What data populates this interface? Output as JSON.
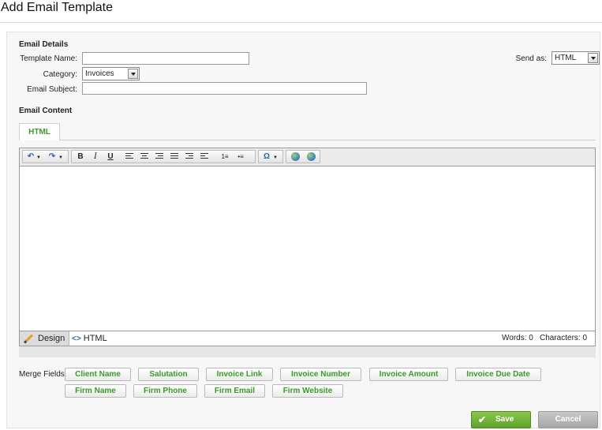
{
  "page": {
    "title": "Add Email Template"
  },
  "details": {
    "section_title": "Email Details",
    "template_name_label": "Template Name:",
    "template_name_value": "",
    "category_label": "Category:",
    "category_value": "Invoices",
    "subject_label": "Email Subject:",
    "subject_value": "",
    "send_as_label": "Send as:",
    "send_as_value": "HTML"
  },
  "content": {
    "section_title": "Email Content",
    "tab_label": "HTML"
  },
  "toolbar": {
    "undo": "↶",
    "redo": "↷",
    "dropdown": "▼",
    "bold": "B",
    "italic": "I",
    "underline": "U",
    "special_char": "Ω",
    "ordered_list": "1≡",
    "unordered_list": "•≡"
  },
  "editor": {
    "design_tab": "Design",
    "html_tab_icon": "<>",
    "html_tab": "HTML",
    "words": "Words: 0",
    "characters": "Characters: 0"
  },
  "merge": {
    "label": "Merge Fields:",
    "fields": [
      "Client Name",
      "Salutation",
      "Invoice Link",
      "Invoice Number",
      "Invoice Amount",
      "Invoice Due Date",
      "Firm Name",
      "Firm Phone",
      "Firm Email",
      "Firm Website"
    ]
  },
  "actions": {
    "save_check": "✔",
    "save": "Save",
    "cancel": "Cancel"
  },
  "icons": {
    "undo": "undo-icon",
    "redo": "redo-icon",
    "bold": "bold-icon",
    "italic": "italic-icon",
    "underline": "underline-icon",
    "align_left": "align-left-icon",
    "align_center": "align-center-icon",
    "align_right": "align-right-icon",
    "justify": "justify-icon",
    "outdent": "outdent-icon",
    "indent": "indent-icon",
    "ordered_list": "ordered-list-icon",
    "unordered_list": "unordered-list-icon",
    "special_char": "omega-icon",
    "link": "link-globe-icon",
    "unlink": "unlink-globe-icon",
    "pencil": "pencil-icon",
    "code": "code-icon",
    "check": "check-icon"
  },
  "colors": {
    "accent_green": "#3f9a2a",
    "save_green": "#6fb13a",
    "cancel_grey": "#b5b5b5",
    "link_blue": "#2a64b8"
  }
}
